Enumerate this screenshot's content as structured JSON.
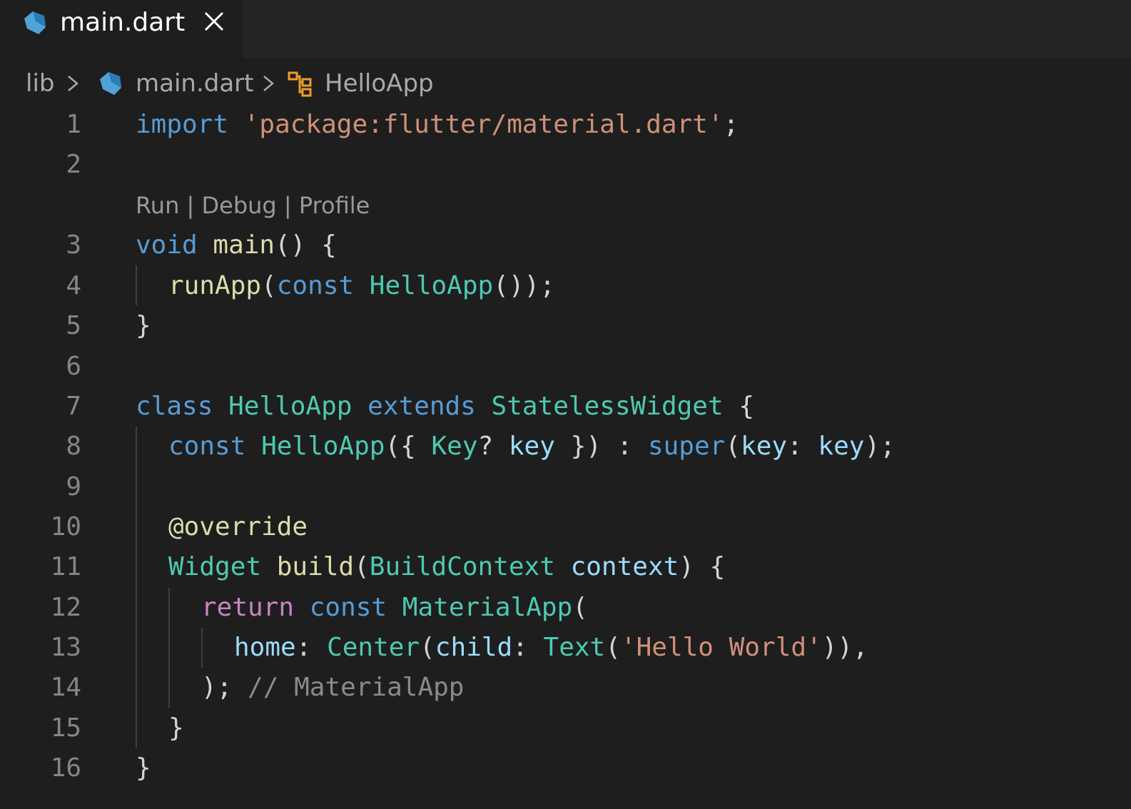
{
  "tab": {
    "label": "main.dart",
    "close_icon": "close-icon",
    "file_icon": "dart-file-icon"
  },
  "breadcrumb": {
    "folder": "lib",
    "file": "main.dart",
    "symbol": "HelloApp",
    "file_icon": "dart-file-icon",
    "symbol_icon": "class-symbol-icon"
  },
  "codelens": {
    "run": "Run",
    "debug": "Debug",
    "profile": "Profile",
    "separator": " | "
  },
  "line_numbers": [
    "1",
    "2",
    "3",
    "4",
    "5",
    "6",
    "7",
    "8",
    "9",
    "10",
    "11",
    "12",
    "13",
    "14",
    "15",
    "16"
  ],
  "code": {
    "l1": {
      "import": "import",
      "sp": " ",
      "str": "'package:flutter/material.dart'",
      "semi": ";"
    },
    "l3": {
      "void": "void",
      "sp": " ",
      "main": "main",
      "rest": "() {"
    },
    "l4": {
      "runApp": "runApp",
      "p1": "(",
      "const": "const",
      "sp": " ",
      "cls": "HelloApp",
      "rest": "());"
    },
    "l5": {
      "brace": "}"
    },
    "l7": {
      "class": "class",
      "sp1": " ",
      "name": "HelloApp",
      "sp2": " ",
      "extends": "extends",
      "sp3": " ",
      "base": "StatelessWidget",
      "rest": " {"
    },
    "l8": {
      "const": "const",
      "sp1": " ",
      "name": "HelloApp",
      "p1": "({ ",
      "type": "Key",
      "q": "? ",
      "key": "key",
      "p2": " }) : ",
      "super": "super",
      "p3": "(",
      "key2": "key",
      "colon": ": ",
      "key3": "key",
      "rest": ");"
    },
    "l10": {
      "ann": "@override"
    },
    "l11": {
      "type": "Widget",
      "sp": " ",
      "fn": "build",
      "p1": "(",
      "ctx": "BuildContext",
      "sp2": " ",
      "var": "context",
      "rest": ") {"
    },
    "l12": {
      "return": "return",
      "sp1": " ",
      "const": "const",
      "sp2": " ",
      "cls": "MaterialApp",
      "rest": "("
    },
    "l13": {
      "home": "home",
      "colon1": ": ",
      "center": "Center",
      "p1": "(",
      "child": "child",
      "colon2": ": ",
      "text": "Text",
      "p2": "(",
      "str": "'Hello World'",
      "rest": ")),"
    },
    "l14": {
      "close": ");",
      "sp": " ",
      "cmt": "// MaterialApp"
    },
    "l15": {
      "brace": "}"
    },
    "l16": {
      "brace": "}"
    }
  },
  "colors": {
    "background": "#1e1e1e",
    "keyword": "#569cd6",
    "control": "#c586c0",
    "string": "#ce9178",
    "function": "#dcdcaa",
    "class": "#4ec9b0",
    "variable": "#9cdcfe",
    "comment": "#8a8a8a",
    "dart_icon": "#4fa3d8",
    "symbol_icon": "#ee9d28"
  }
}
